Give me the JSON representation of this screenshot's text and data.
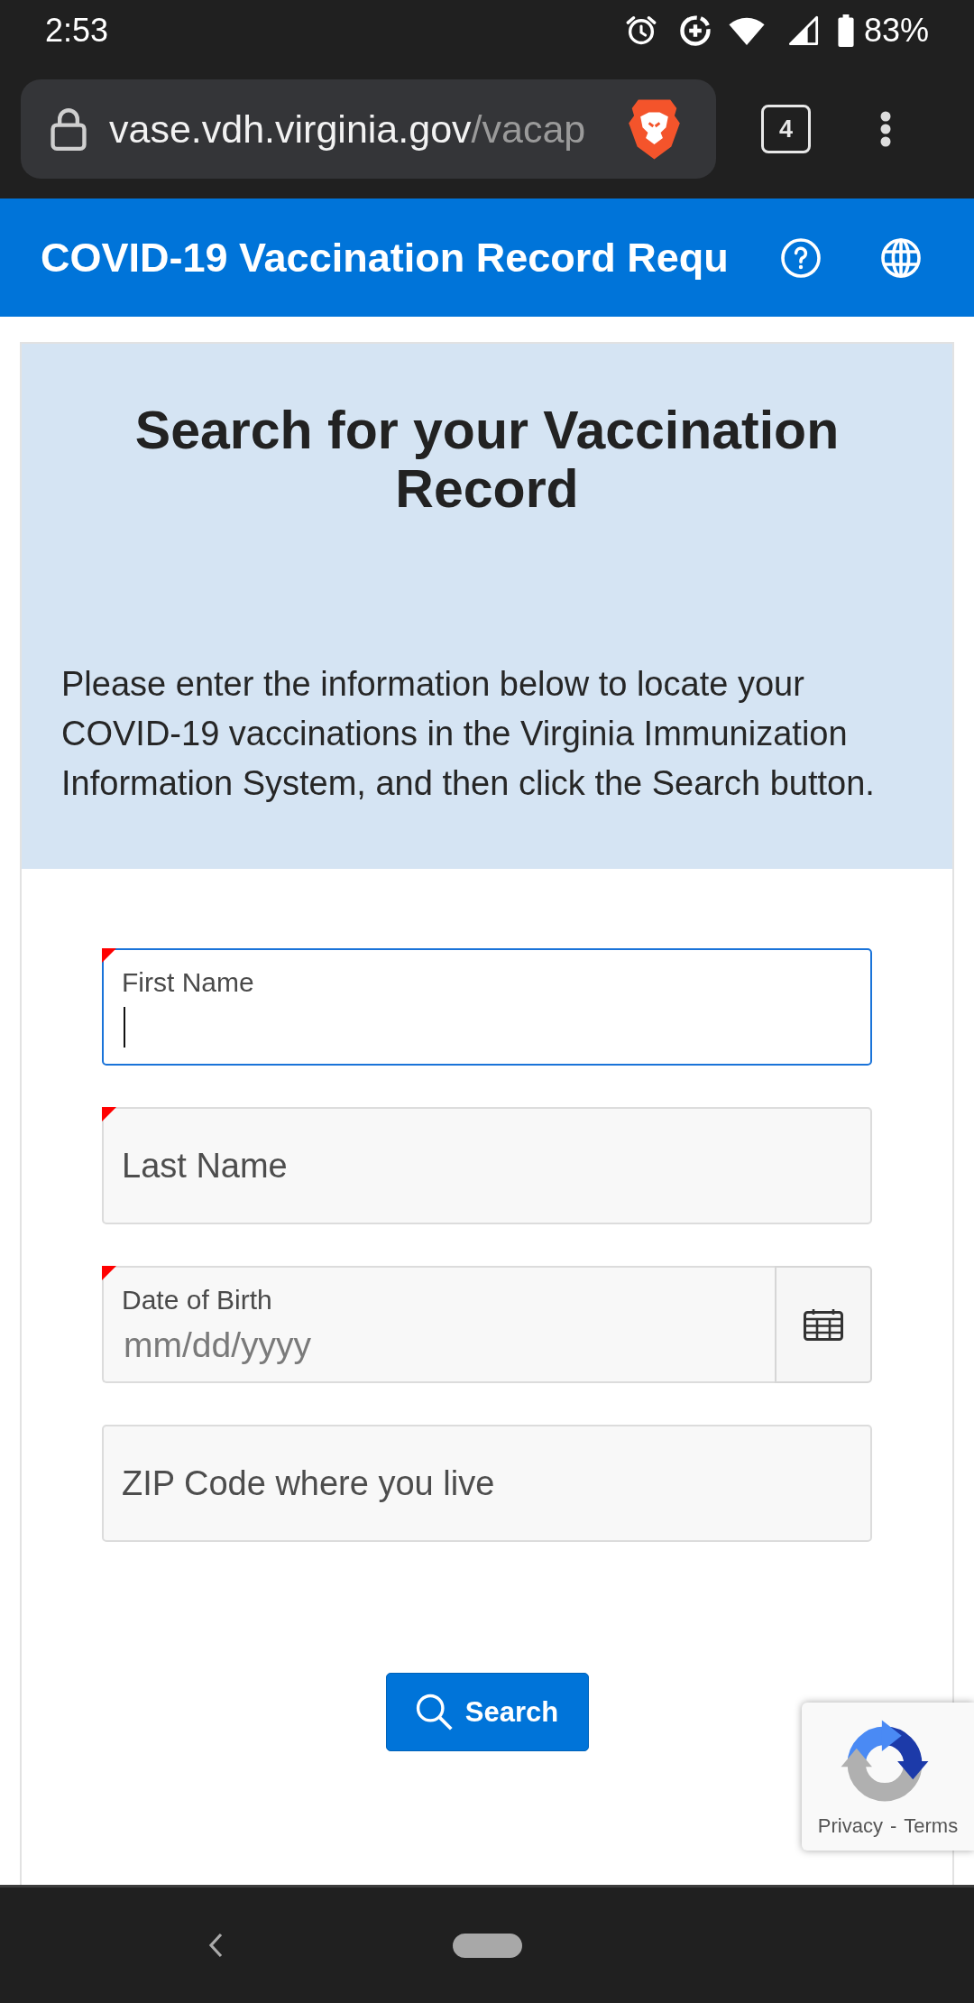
{
  "status_bar": {
    "time": "2:53",
    "battery": "83%"
  },
  "browser": {
    "url_host": "vase.vdh.virginia.gov",
    "url_path": "/vacap",
    "tab_count": "4"
  },
  "header": {
    "title": "COVID-19 Vaccination Record Requ"
  },
  "intro": {
    "heading": "Search for your Vaccination Record",
    "text": "Please enter the information below to locate your COVID-19 vaccinations in the Virginia Immunization Information System, and then click the Search button."
  },
  "form": {
    "fields": [
      {
        "kind": "text",
        "label": "First Name",
        "required": true,
        "focused": true
      },
      {
        "kind": "text",
        "label": "Last Name",
        "required": true,
        "focused": false
      },
      {
        "kind": "date",
        "label": "Date of Birth",
        "placeholder": "mm/dd/yyyy",
        "required": true,
        "focused": false
      },
      {
        "kind": "text",
        "label": "ZIP Code where you live",
        "required": false,
        "focused": false
      }
    ],
    "submit": {
      "label": "Search"
    }
  },
  "recaptcha": {
    "links": [
      "Privacy",
      "Terms"
    ],
    "separator": "-"
  }
}
